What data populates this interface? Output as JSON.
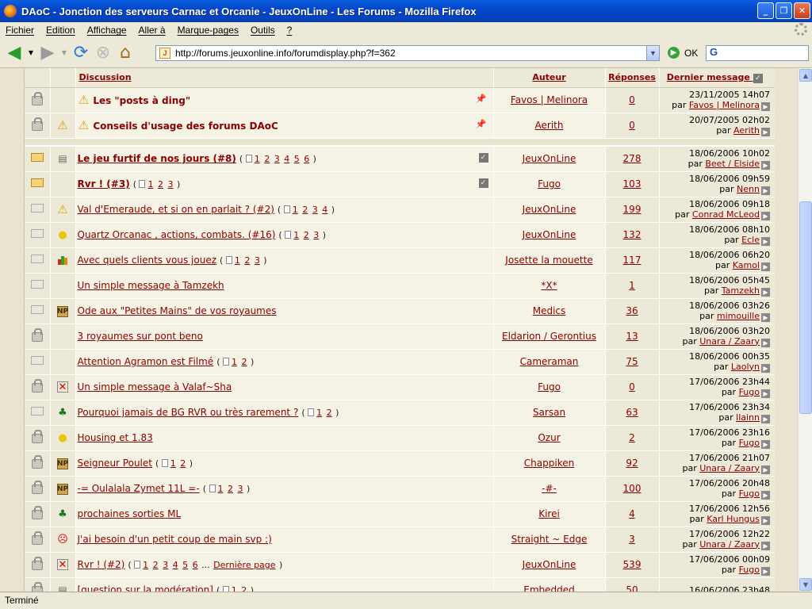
{
  "window": {
    "title": "DAoC - Jonction des serveurs Carnac et Orcanie - JeuxOnLine - Les Forums - Mozilla Firefox",
    "minimize": "_",
    "maximize": "❐",
    "close": "✕"
  },
  "menu": [
    "Fichier",
    "Edition",
    "Affichage",
    "Aller à",
    "Marque-pages",
    "Outils",
    "?"
  ],
  "nav": {
    "url": "http://forums.jeuxonline.info/forumdisplay.php?f=362",
    "go_label": "OK",
    "search_logo": "G"
  },
  "headers": {
    "topic": "Discussion",
    "author": "Auteur",
    "replies": "Réponses",
    "last": "Dernier message"
  },
  "announcements": [
    {
      "icon": "warning-icon",
      "title": "Les \"posts à ding\"",
      "author": "Favos | Melinora",
      "replies": "0",
      "date": "23/11/2005 14h07",
      "by_prefix": "par",
      "by": "Favos | Melinora"
    },
    {
      "icon": "warning-icon",
      "title": "Conseils d'usage des forums DAoC",
      "author": "Aerith",
      "replies": "0",
      "date": "20/07/2005 02h02",
      "by_prefix": "par",
      "by": "Aerith"
    }
  ],
  "topics": [
    {
      "status": "hot-new",
      "icon": "page-icon",
      "title": "Le jeu furtif de nos jours (#8)",
      "bold": true,
      "pages": [
        "1",
        "2",
        "3",
        "4",
        "5",
        "6"
      ],
      "author": "JeuxOnLine",
      "replies": "278",
      "date": "18/06/2006 10h02",
      "by": "Beet / Elside",
      "check": true
    },
    {
      "status": "hot-new",
      "icon": "",
      "title": "Rvr ! (#3)",
      "bold": true,
      "pages": [
        "1",
        "2",
        "3"
      ],
      "author": "Fugo",
      "replies": "103",
      "date": "18/06/2006 09h59",
      "by": "Nenn",
      "check": true
    },
    {
      "status": "normal",
      "icon": "warning-icon",
      "title": "Val d'Emeraude, et si on en parlait ? (#2)",
      "bold": false,
      "pages": [
        "1",
        "2",
        "3",
        "4"
      ],
      "author": "JeuxOnLine",
      "replies": "199",
      "date": "18/06/2006 09h18",
      "by": "Conrad McLeod"
    },
    {
      "status": "normal",
      "icon": "lightbulb-icon",
      "title": "Quartz Orcanac , actions, combats. (#16)",
      "bold": false,
      "pages": [
        "1",
        "2",
        "3"
      ],
      "author": "JeuxOnLine",
      "replies": "132",
      "date": "18/06/2006 08h10",
      "by": "Ecle"
    },
    {
      "status": "normal",
      "icon": "barchart-icon",
      "title": "Avec quels clients vous jouez",
      "bold": false,
      "pages": [
        "1",
        "2",
        "3"
      ],
      "author": "Josette la mouette",
      "replies": "117",
      "date": "18/06/2006 06h20",
      "by": "Kamol"
    },
    {
      "status": "normal",
      "icon": "",
      "title": "Un simple message à Tamzekh",
      "bold": false,
      "pages": [],
      "author": "*X*",
      "replies": "1",
      "date": "18/06/2006 05h45",
      "by": "Tamzekh"
    },
    {
      "status": "normal",
      "icon": "np-icon",
      "title": "Ode aux \"Petites Mains\" de vos royaumes",
      "bold": false,
      "pages": [],
      "author": "Medics",
      "replies": "36",
      "date": "18/06/2006 03h26",
      "by": "mimouille"
    },
    {
      "status": "locked",
      "icon": "",
      "title": "3 royaumes sur pont beno",
      "bold": false,
      "pages": [],
      "author": "Eldarion / Gerontius",
      "replies": "13",
      "date": "18/06/2006 03h20",
      "by": "Unara / Zaary"
    },
    {
      "status": "normal",
      "icon": "",
      "title": "Attention Agramon est Filmé",
      "bold": false,
      "pages": [
        "1",
        "2"
      ],
      "author": "Cameraman",
      "replies": "75",
      "date": "18/06/2006 00h35",
      "by": "Laolyn"
    },
    {
      "status": "locked",
      "icon": "cross-icon",
      "title": "Un simple message à Valaf~Sha",
      "bold": false,
      "pages": [],
      "author": "Fugo",
      "replies": "0",
      "date": "17/06/2006 23h44",
      "by": "Fugo"
    },
    {
      "status": "normal",
      "icon": "tree-icon",
      "title": "Pourquoi jamais de BG RVR ou très rarement ?",
      "bold": false,
      "pages": [
        "1",
        "2"
      ],
      "author": "Sarsan",
      "replies": "63",
      "date": "17/06/2006 23h34",
      "by": "llainn"
    },
    {
      "status": "locked",
      "icon": "lightbulb-icon",
      "title": "Housing et 1.83",
      "bold": false,
      "pages": [],
      "author": "Ozur",
      "replies": "2",
      "date": "17/06/2006 23h16",
      "by": "Fugo"
    },
    {
      "status": "locked",
      "icon": "np-icon",
      "title": "Seigneur Poulet",
      "bold": false,
      "pages": [
        "1",
        "2"
      ],
      "author": "Chappiken",
      "replies": "92",
      "date": "17/06/2006 21h07",
      "by": "Unara / Zaary"
    },
    {
      "status": "locked",
      "icon": "np-icon",
      "title": "-= Oulalala Zymet 11L =-",
      "bold": false,
      "pages": [
        "1",
        "2",
        "3"
      ],
      "author": "-#-",
      "replies": "100",
      "date": "17/06/2006 20h48",
      "by": "Fugo"
    },
    {
      "status": "locked",
      "icon": "tree-icon",
      "title": "prochaines sorties ML",
      "bold": false,
      "pages": [],
      "author": "Kirei",
      "replies": "4",
      "date": "17/06/2006 12h56",
      "by": "Karl Hungus"
    },
    {
      "status": "locked",
      "icon": "sad-face-icon",
      "title": "J'ai besoin d'un petit coup de main svp :)",
      "bold": false,
      "pages": [],
      "author": "Straight ~ Edge",
      "replies": "3",
      "date": "17/06/2006 12h22",
      "by": "Unara / Zaary"
    },
    {
      "status": "locked",
      "icon": "cross-icon",
      "title": "Rvr ! (#2)",
      "bold": false,
      "pages": [
        "1",
        "2",
        "3",
        "4",
        "5",
        "6"
      ],
      "last_page": "Dernière page",
      "author": "JeuxOnLine",
      "replies": "539",
      "date": "17/06/2006 00h09",
      "by": "Fugo"
    },
    {
      "status": "locked",
      "icon": "page-icon",
      "title": "[question sur la modération]",
      "bold": false,
      "pages": [
        "1",
        "2"
      ],
      "author": "Embedded",
      "replies": "50",
      "date": "16/06/2006 23h48",
      "by": ""
    }
  ],
  "by_prefix": "par",
  "ellipsis": "...",
  "status_text": "Terminé"
}
